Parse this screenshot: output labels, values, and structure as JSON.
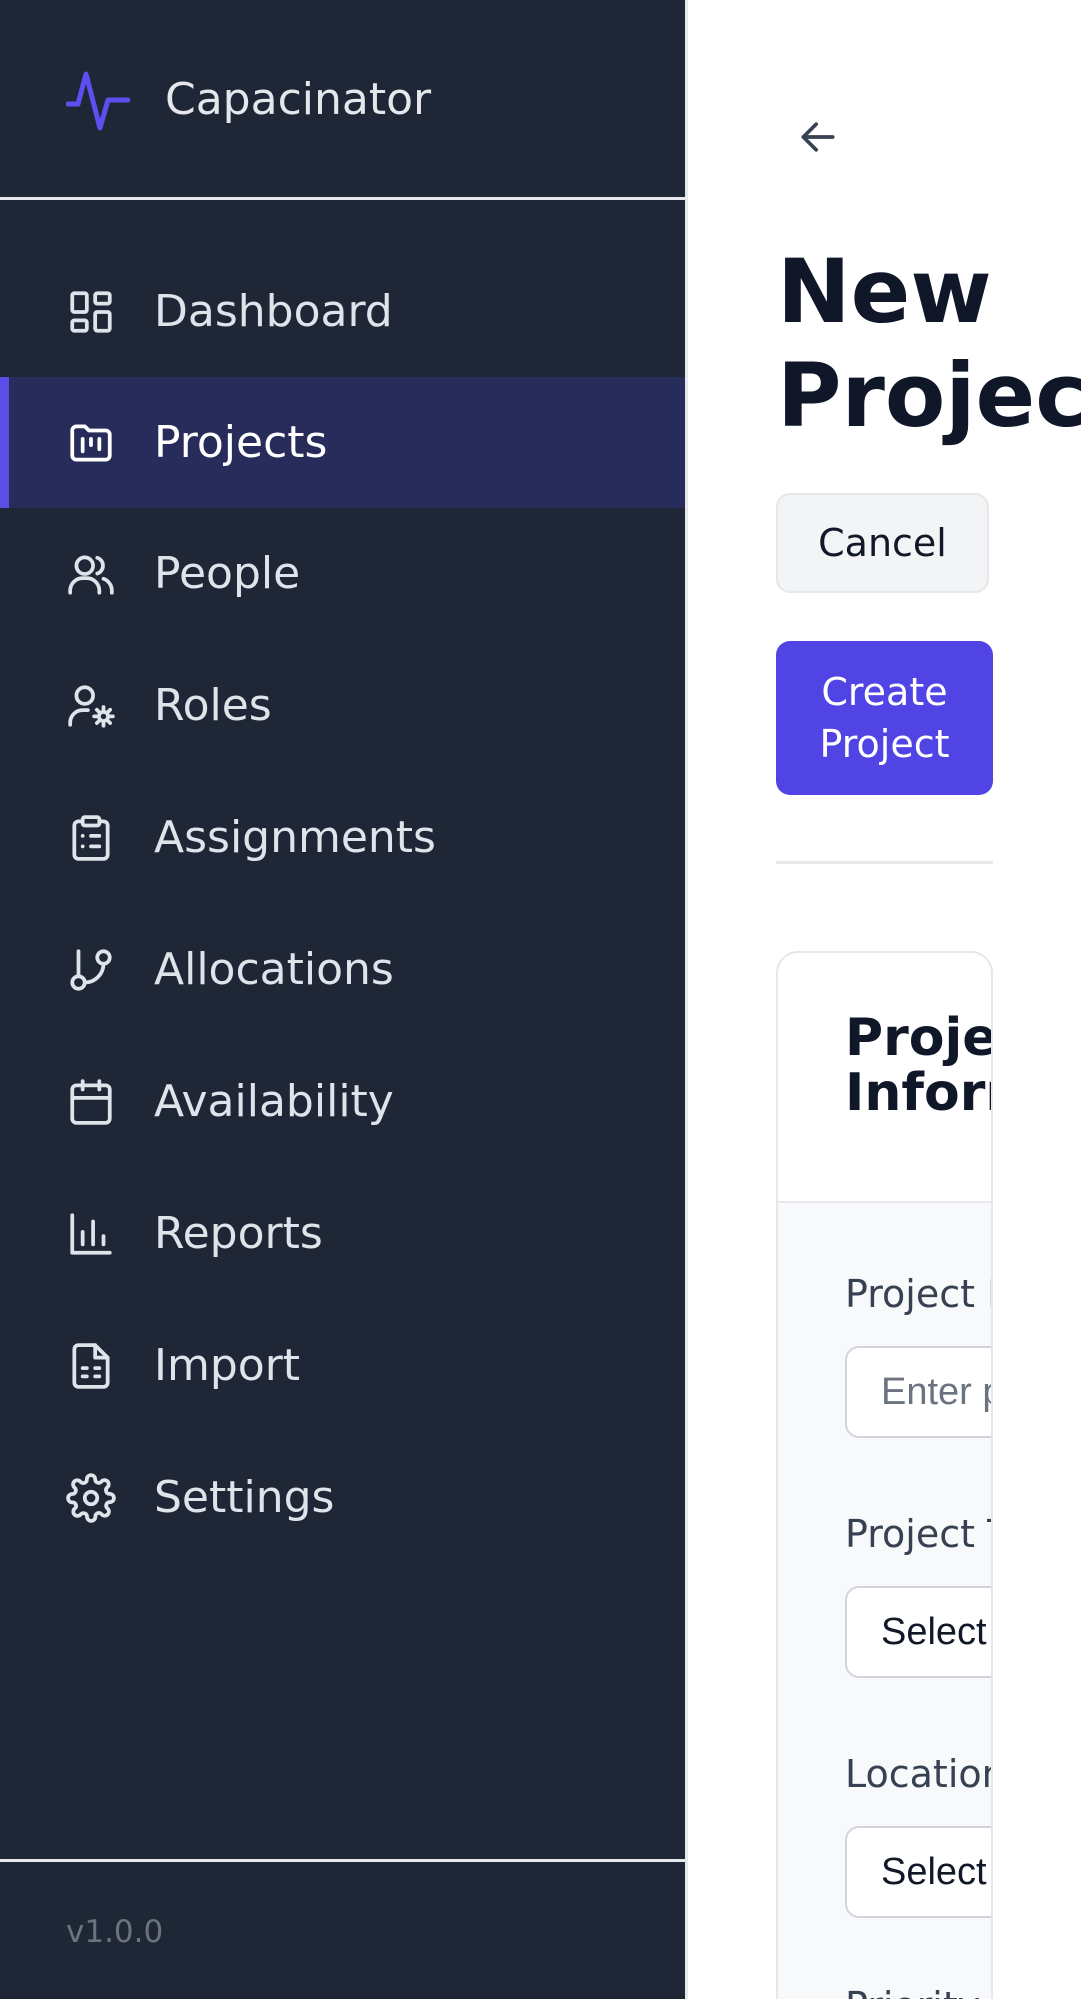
{
  "app": {
    "name": "Capacinator",
    "version": "v1.0.0",
    "accent_color": "#4f46e5"
  },
  "sidebar": {
    "items": [
      {
        "label": "Dashboard",
        "icon": "dashboard-icon",
        "active": false
      },
      {
        "label": "Projects",
        "icon": "folder-kanban-icon",
        "active": true
      },
      {
        "label": "People",
        "icon": "users-icon",
        "active": false
      },
      {
        "label": "Roles",
        "icon": "user-cog-icon",
        "active": false
      },
      {
        "label": "Assignments",
        "icon": "clipboard-list-icon",
        "active": false
      },
      {
        "label": "Allocations",
        "icon": "git-branch-icon",
        "active": false
      },
      {
        "label": "Availability",
        "icon": "calendar-icon",
        "active": false
      },
      {
        "label": "Reports",
        "icon": "bar-chart-icon",
        "active": false
      },
      {
        "label": "Import",
        "icon": "file-spreadsheet-icon",
        "active": false
      },
      {
        "label": "Settings",
        "icon": "gear-icon",
        "active": false
      }
    ]
  },
  "main": {
    "back_icon": "arrow-left-icon",
    "title_line1": "New",
    "title_line2": "Project",
    "cancel_label": "Cancel",
    "create_line1": "Create",
    "create_line2": "Project",
    "card": {
      "title_line1": "Project",
      "title_line2": "Information",
      "fields": [
        {
          "label": "Project Name",
          "placeholder": "Enter project name"
        },
        {
          "label": "Project Type",
          "value": "Select project type"
        },
        {
          "label": "Location",
          "value": "Select location"
        },
        {
          "label": "Priority"
        }
      ]
    }
  }
}
